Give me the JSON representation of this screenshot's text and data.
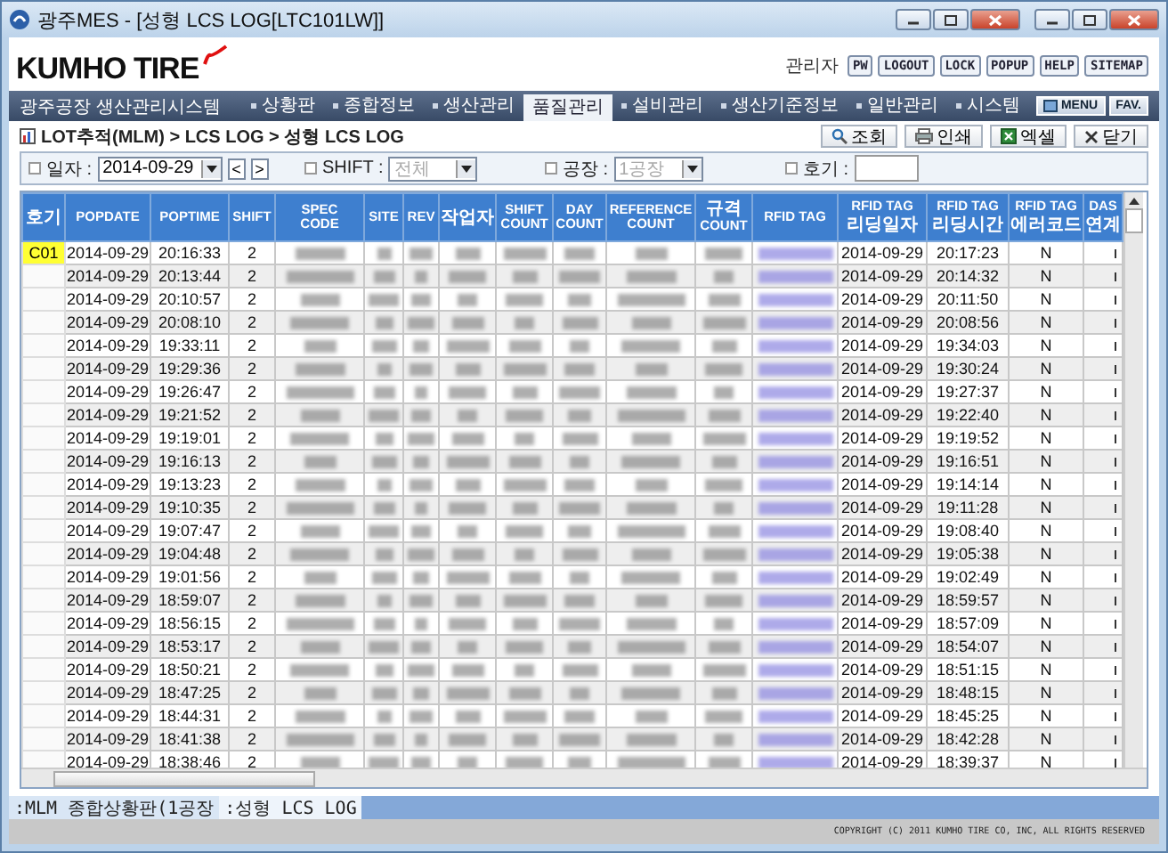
{
  "window": {
    "title": "광주MES - [성형 LCS LOG[LTC101LW]]"
  },
  "header": {
    "logo": "KUMHO TIRE",
    "user": "관리자",
    "buttons": [
      "PW",
      "LOGOUT",
      "LOCK",
      "POPUP",
      "HELP",
      "SITEMAP"
    ]
  },
  "nav": {
    "system_title": "광주공장 생산관리시스템",
    "items": [
      {
        "label": "상황판",
        "selected": false
      },
      {
        "label": "종합정보",
        "selected": false
      },
      {
        "label": "생산관리",
        "selected": false
      },
      {
        "label": "품질관리",
        "selected": true
      },
      {
        "label": "설비관리",
        "selected": false
      },
      {
        "label": "생산기준정보",
        "selected": false
      },
      {
        "label": "일반관리",
        "selected": false
      },
      {
        "label": "시스템",
        "selected": false
      }
    ],
    "buttons": [
      "MENU",
      "FAV."
    ]
  },
  "breadcrumb": "LOT추적(MLM) > LCS LOG > 성형 LCS LOG",
  "actions": [
    {
      "kind": "search",
      "label": "조회"
    },
    {
      "kind": "print",
      "label": "인쇄"
    },
    {
      "kind": "excel",
      "label": "엑셀"
    },
    {
      "kind": "close",
      "label": "닫기"
    }
  ],
  "filters": [
    {
      "kind": "date",
      "label": "일자 :",
      "value": "2014-09-29",
      "prev": "<",
      "next": ">",
      "disabled": false
    },
    {
      "kind": "select",
      "label": "SHIFT :",
      "value": "전체",
      "disabled": true
    },
    {
      "kind": "select",
      "label": "공장 :",
      "value": "1공장",
      "disabled": true
    },
    {
      "kind": "input",
      "label": "호기 :"
    }
  ],
  "table": {
    "columns": [
      {
        "label": "호기",
        "kind": "unit"
      },
      {
        "label": "POPDATE",
        "kind": "text"
      },
      {
        "label": "POPTIME",
        "kind": "text"
      },
      {
        "label": "SHIFT",
        "kind": "text"
      },
      {
        "label": "SPEC CODE",
        "kind": "hidden"
      },
      {
        "label": "SITE",
        "kind": "hidden"
      },
      {
        "label": "REV",
        "kind": "hidden"
      },
      {
        "label": "작업자",
        "kind": "hidden"
      },
      {
        "label": "SHIFT COUNT",
        "kind": "hidden"
      },
      {
        "label": "DAY COUNT",
        "kind": "hidden"
      },
      {
        "label": "REFERENCE COUNT",
        "kind": "hidden"
      },
      {
        "label": "규격 COUNT",
        "kind": "hidden"
      },
      {
        "label": "RFID TAG",
        "kind": "tag"
      },
      {
        "label": "RFID TAG 리딩일자",
        "kind": "text"
      },
      {
        "label": "RFID TAG 리딩시간",
        "kind": "text"
      },
      {
        "label": "RFID TAG 에러코드",
        "kind": "text"
      },
      {
        "label": "DAS 연계",
        "kind": "cut"
      }
    ],
    "rows": [
      {
        "unit": "C01",
        "popdate": "2014-09-29",
        "poptime": "20:16:33",
        "shift": "2",
        "read_date": "2014-09-29",
        "read_time": "20:17:23",
        "error": "N"
      },
      {
        "popdate": "2014-09-29",
        "poptime": "20:13:44",
        "shift": "2",
        "read_date": "2014-09-29",
        "read_time": "20:14:32",
        "error": "N"
      },
      {
        "popdate": "2014-09-29",
        "poptime": "20:10:57",
        "shift": "2",
        "read_date": "2014-09-29",
        "read_time": "20:11:50",
        "error": "N"
      },
      {
        "popdate": "2014-09-29",
        "poptime": "20:08:10",
        "shift": "2",
        "read_date": "2014-09-29",
        "read_time": "20:08:56",
        "error": "N"
      },
      {
        "popdate": "2014-09-29",
        "poptime": "19:33:11",
        "shift": "2",
        "read_date": "2014-09-29",
        "read_time": "19:34:03",
        "error": "N"
      },
      {
        "popdate": "2014-09-29",
        "poptime": "19:29:36",
        "shift": "2",
        "read_date": "2014-09-29",
        "read_time": "19:30:24",
        "error": "N"
      },
      {
        "popdate": "2014-09-29",
        "poptime": "19:26:47",
        "shift": "2",
        "read_date": "2014-09-29",
        "read_time": "19:27:37",
        "error": "N"
      },
      {
        "popdate": "2014-09-29",
        "poptime": "19:21:52",
        "shift": "2",
        "read_date": "2014-09-29",
        "read_time": "19:22:40",
        "error": "N"
      },
      {
        "popdate": "2014-09-29",
        "poptime": "19:19:01",
        "shift": "2",
        "read_date": "2014-09-29",
        "read_time": "19:19:52",
        "error": "N"
      },
      {
        "popdate": "2014-09-29",
        "poptime": "19:16:13",
        "shift": "2",
        "read_date": "2014-09-29",
        "read_time": "19:16:51",
        "error": "N"
      },
      {
        "popdate": "2014-09-29",
        "poptime": "19:13:23",
        "shift": "2",
        "read_date": "2014-09-29",
        "read_time": "19:14:14",
        "error": "N"
      },
      {
        "popdate": "2014-09-29",
        "poptime": "19:10:35",
        "shift": "2",
        "read_date": "2014-09-29",
        "read_time": "19:11:28",
        "error": "N"
      },
      {
        "popdate": "2014-09-29",
        "poptime": "19:07:47",
        "shift": "2",
        "read_date": "2014-09-29",
        "read_time": "19:08:40",
        "error": "N"
      },
      {
        "popdate": "2014-09-29",
        "poptime": "19:04:48",
        "shift": "2",
        "read_date": "2014-09-29",
        "read_time": "19:05:38",
        "error": "N"
      },
      {
        "popdate": "2014-09-29",
        "poptime": "19:01:56",
        "shift": "2",
        "read_date": "2014-09-29",
        "read_time": "19:02:49",
        "error": "N"
      },
      {
        "popdate": "2014-09-29",
        "poptime": "18:59:07",
        "shift": "2",
        "read_date": "2014-09-29",
        "read_time": "18:59:57",
        "error": "N"
      },
      {
        "popdate": "2014-09-29",
        "poptime": "18:56:15",
        "shift": "2",
        "read_date": "2014-09-29",
        "read_time": "18:57:09",
        "error": "N"
      },
      {
        "popdate": "2014-09-29",
        "poptime": "18:53:17",
        "shift": "2",
        "read_date": "2014-09-29",
        "read_time": "18:54:07",
        "error": "N"
      },
      {
        "popdate": "2014-09-29",
        "poptime": "18:50:21",
        "shift": "2",
        "read_date": "2014-09-29",
        "read_time": "18:51:15",
        "error": "N"
      },
      {
        "popdate": "2014-09-29",
        "poptime": "18:47:25",
        "shift": "2",
        "read_date": "2014-09-29",
        "read_time": "18:48:15",
        "error": "N"
      },
      {
        "popdate": "2014-09-29",
        "poptime": "18:44:31",
        "shift": "2",
        "read_date": "2014-09-29",
        "read_time": "18:45:25",
        "error": "N"
      },
      {
        "popdate": "2014-09-29",
        "poptime": "18:41:38",
        "shift": "2",
        "read_date": "2014-09-29",
        "read_time": "18:42:28",
        "error": "N"
      },
      {
        "popdate": "2014-09-29",
        "poptime": "18:38:46",
        "shift": "2",
        "read_date": "2014-09-29",
        "read_time": "18:39:37",
        "error": "N"
      }
    ]
  },
  "bottom_tabs": [
    {
      "label": ":MLM 종합상황판(1공장",
      "selected": false
    },
    {
      "label": ":성형 LCS LOG",
      "selected": true
    }
  ],
  "footer": "COPYRIGHT (C) 2011 KUMHO TIRE CO, INC, ALL RIGHTS RESERVED"
}
